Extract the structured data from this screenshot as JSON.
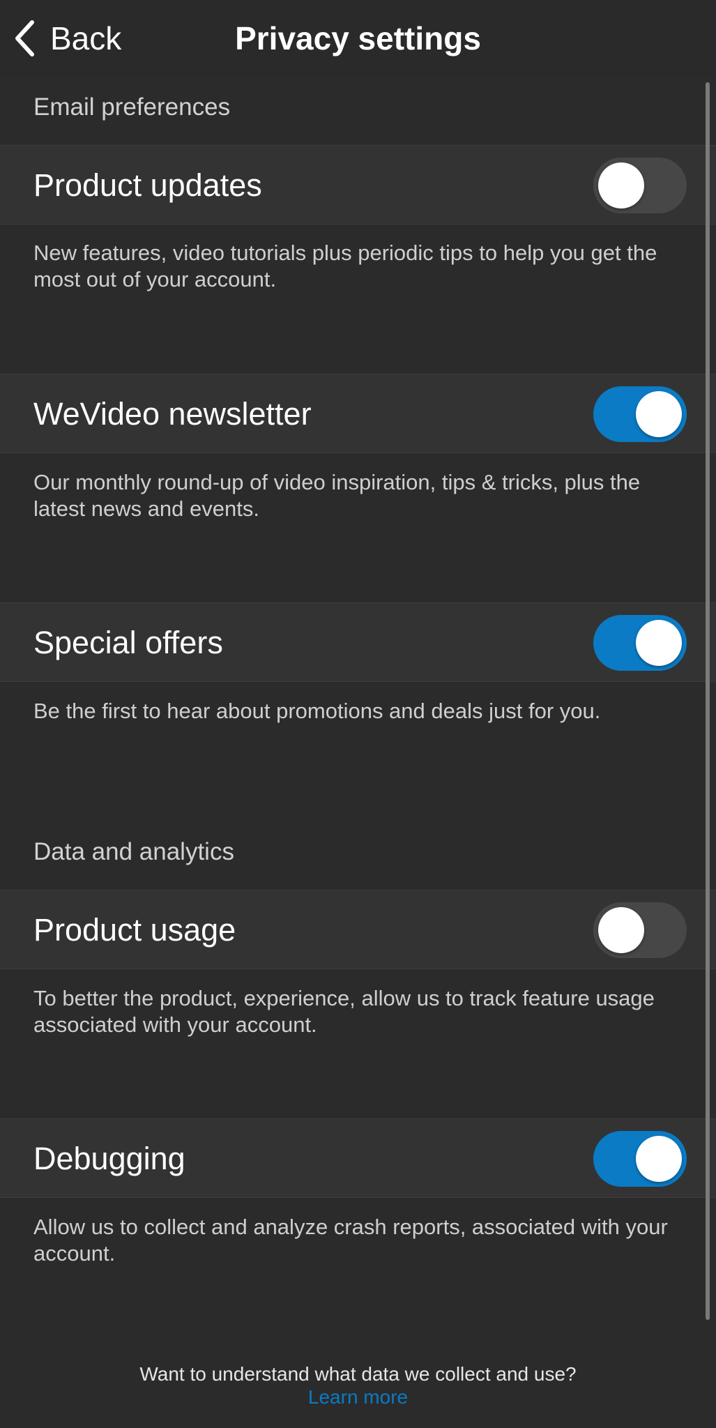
{
  "header": {
    "back_label": "Back",
    "title": "Privacy settings"
  },
  "sections": [
    {
      "title": "Email preferences",
      "items": [
        {
          "label": "Product updates",
          "enabled": false,
          "description": "New features, video tutorials plus periodic tips to help you get the most out of your account."
        },
        {
          "label": "WeVideo newsletter",
          "enabled": true,
          "description": "Our monthly round-up of video inspiration, tips & tricks, plus the latest news and events."
        },
        {
          "label": "Special offers",
          "enabled": true,
          "description": "Be the first to hear about promotions and deals just for you."
        }
      ]
    },
    {
      "title": "Data and analytics",
      "items": [
        {
          "label": "Product usage",
          "enabled": false,
          "description": "To better the product, experience, allow us to track feature usage associated with your account."
        },
        {
          "label": "Debugging",
          "enabled": true,
          "description": "Allow us to collect and analyze crash reports, associated with your account."
        }
      ]
    }
  ],
  "footer": {
    "text": "Want to understand what data we collect and use?",
    "link_label": "Learn more"
  },
  "colors": {
    "accent": "#0a7bc4",
    "background": "#2b2b2b",
    "row_background": "#333333",
    "toggle_off": "#474747"
  },
  "icons": {
    "back": "chevron-left-icon"
  }
}
